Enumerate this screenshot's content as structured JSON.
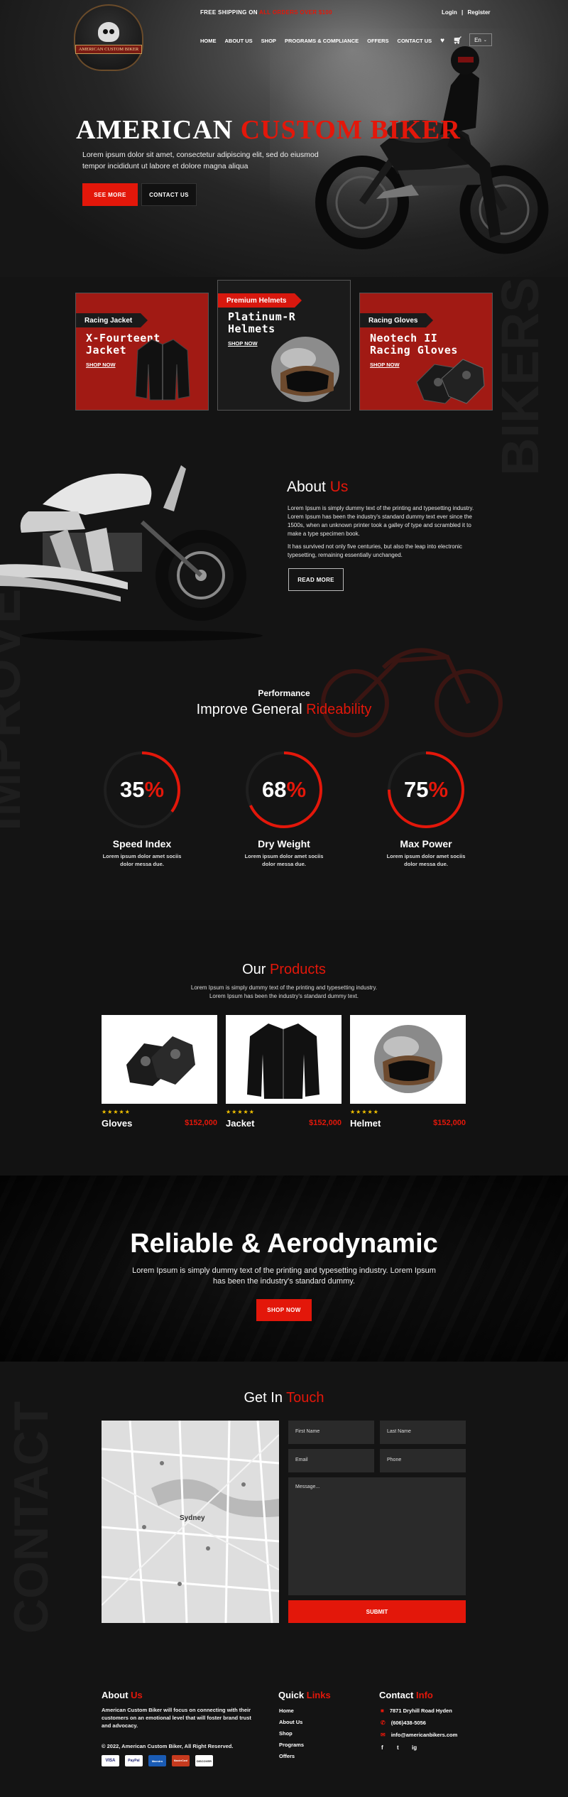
{
  "header": {
    "logo_text": "AMERICAN CUSTOM BIKER",
    "shipping_prefix": "FREE SHIPPING ON",
    "shipping_highlight": "ALL ORDERS OVER $100",
    "login": "Login",
    "separator": "|",
    "register": "Register",
    "nav": [
      "HOME",
      "ABOUT US",
      "SHOP",
      "PROGRAMS & COMPLIANCE",
      "OFFERS",
      "CONTACT US"
    ],
    "language": "En"
  },
  "hero": {
    "title_white": "AMERICAN",
    "title_red": "CUSTOM BIKER",
    "subtitle": "Lorem ipsum dolor sit amet, consectetur adipiscing elit, sed do eiusmod tempor incididunt ut labore et dolore magna aliqua",
    "see_more": "SEE MORE",
    "contact_us": "CONTACT US"
  },
  "categories": [
    {
      "tag": "Racing Jacket",
      "name_1": "X-Fourteent",
      "name_2": "Jacket",
      "shop": "SHOP NOW"
    },
    {
      "tag": "Premium Helmets",
      "name_1": "Platinum-R",
      "name_2": "Helmets",
      "shop": "SHOP NOW"
    },
    {
      "tag": "Racing Gloves",
      "name_1": "Neotech II",
      "name_2": "Racing Gloves",
      "shop": "SHOP NOW"
    }
  ],
  "about": {
    "title_white": "About",
    "title_red": "Us",
    "p1": "Lorem Ipsum is simply dummy text of the printing and typesetting industry. Lorem Ipsum has been the industry's standard dummy text ever since the 1500s, when an unknown printer took a galley of type and scrambled it to make a type specimen book.",
    "p2": "It has survived not only five centuries, but also the leap into electronic typesetting, remaining essentially unchanged.",
    "read_more": "READ MORE",
    "bg_word_right": "BIKERS",
    "bg_word_left": "IMPROVE"
  },
  "performance": {
    "kicker": "Performance",
    "title_white": "Improve General",
    "title_red": "Rideability",
    "stats": [
      {
        "value": "35",
        "suffix": "%",
        "fraction": 0.35,
        "title": "Speed Index",
        "desc_1": "Lorem ipsum dolor amet sociis",
        "desc_2": "dolor messa due."
      },
      {
        "value": "68",
        "suffix": "%",
        "fraction": 0.68,
        "title": "Dry Weight",
        "desc_1": "Lorem ipsum dolor amet sociis",
        "desc_2": "dolor messa due."
      },
      {
        "value": "75",
        "suffix": "%",
        "fraction": 0.75,
        "title": "Max Power",
        "desc_1": "Lorem ipsum dolor amet sociis",
        "desc_2": "dolor messa due."
      }
    ]
  },
  "products": {
    "title_white": "Our",
    "title_red": "Products",
    "desc_1": "Lorem Ipsum is simply dummy text of the printing and typesetting industry.",
    "desc_2": "Lorem Ipsum has been the industry's standard dummy text.",
    "items": [
      {
        "name": "Gloves",
        "price": "$152,000",
        "stars": "★★★★★"
      },
      {
        "name": "Jacket",
        "price": "$152,000",
        "stars": "★★★★★"
      },
      {
        "name": "Helmet",
        "price": "$152,000",
        "stars": "★★★★★"
      }
    ]
  },
  "banner": {
    "title": "Reliable & Aerodynamic",
    "desc": "Lorem Ipsum is simply dummy text of the printing and typesetting industry. Lorem Ipsum has been the industry's standard dummy.",
    "button": "SHOP NOW"
  },
  "contact": {
    "title_white": "Get In",
    "title_red": "Touch",
    "bg_word": "CONTACT",
    "first_name": "First Name",
    "last_name": "Last Name",
    "email": "Email",
    "phone": "Phone",
    "message": "Message...",
    "submit": "SUBMIT",
    "map_city": "Sydney"
  },
  "footer": {
    "about_white": "About",
    "about_red": "Us",
    "about_text": "American Custom Biker will focus on connecting with their customers on an emotional level that will foster brand trust and advocacy.",
    "copyright": "© 2022, American Custom Biker, All Right Reserved.",
    "quick_white": "Quick",
    "quick_red": "Links",
    "links": [
      "Home",
      "About Us",
      "Shop",
      "Programs",
      "Offers"
    ],
    "contact_white": "Contact",
    "contact_red": "Info",
    "address": "7871 Dryhill Road Hyden",
    "phone": "(606)438-5056",
    "email": "info@americanbikers.com",
    "payments": [
      "VISA",
      "PayPal",
      "Maestro",
      "MasterCard",
      "DISCOVER"
    ],
    "social": [
      "f",
      "t",
      "ig"
    ]
  },
  "colors": {
    "accent": "#e3170a",
    "background": "#141414"
  }
}
